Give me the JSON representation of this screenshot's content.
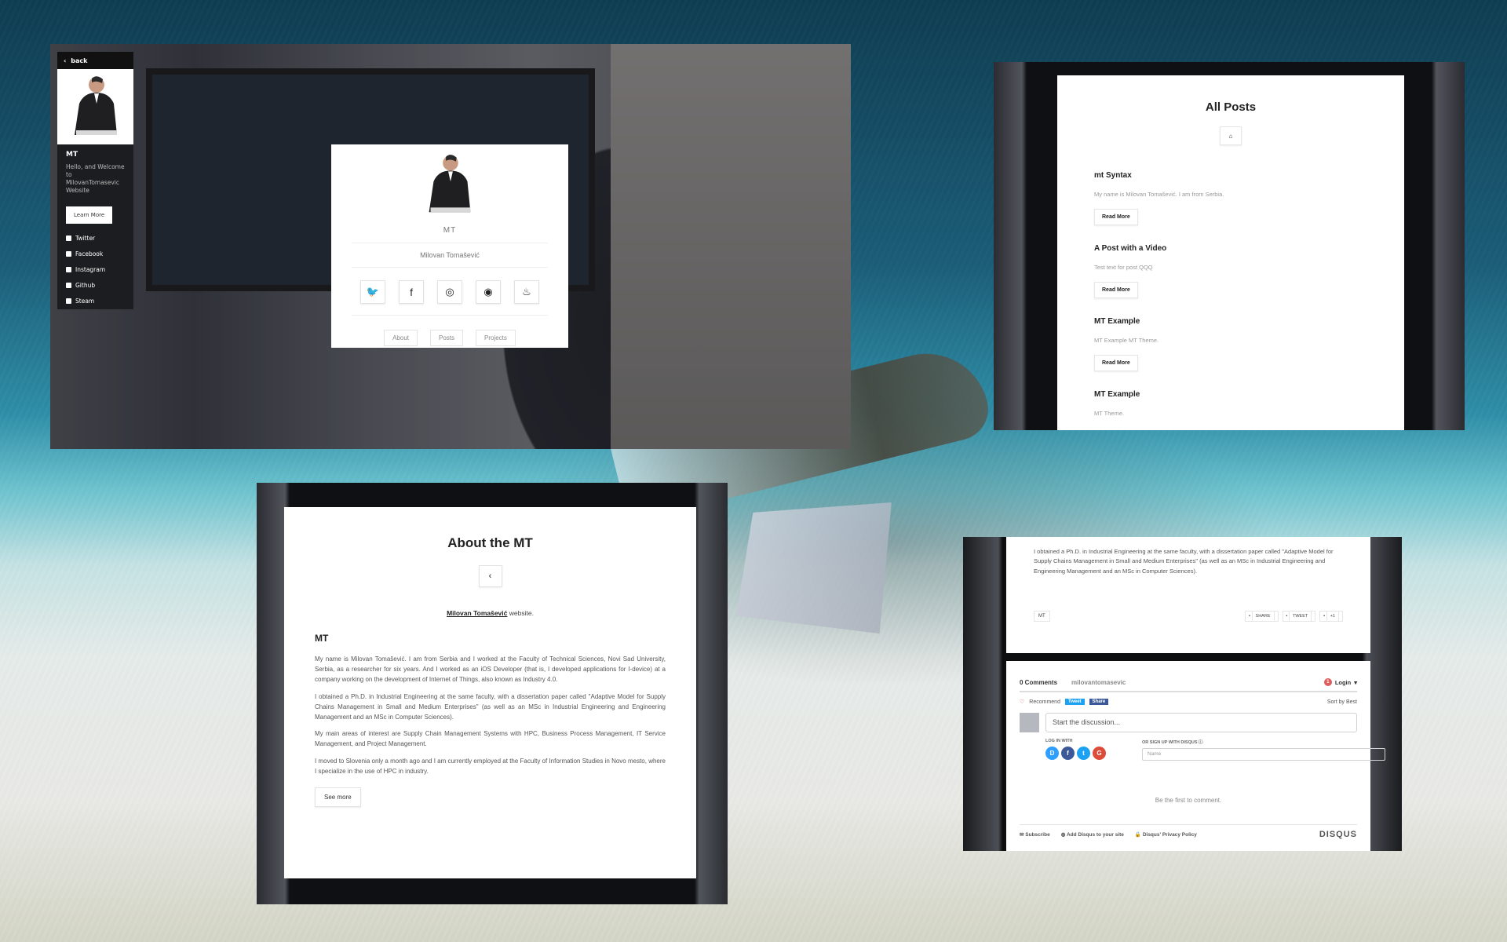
{
  "sidebar": {
    "back": "back",
    "name": "MT",
    "welcome": "Hello, and Welcome to MilovanTomasevic Website",
    "learn_more": "Learn More",
    "links": [
      {
        "label": "Twitter",
        "icon": "twitter-icon"
      },
      {
        "label": "Facebook",
        "icon": "facebook-icon"
      },
      {
        "label": "Instagram",
        "icon": "instagram-icon"
      },
      {
        "label": "Github",
        "icon": "github-icon"
      },
      {
        "label": "Steam",
        "icon": "steam-icon"
      }
    ]
  },
  "profile": {
    "title": "MT",
    "full_name": "Milovan Tomašević",
    "socials": [
      {
        "icon": "twitter-icon",
        "glyph": "🐦"
      },
      {
        "icon": "facebook-icon",
        "glyph": "f"
      },
      {
        "icon": "instagram-icon",
        "glyph": "◎"
      },
      {
        "icon": "github-icon",
        "glyph": "◉"
      },
      {
        "icon": "steam-icon",
        "glyph": "♨"
      }
    ],
    "nav": [
      "About",
      "Posts",
      "Projects"
    ]
  },
  "all_posts": {
    "title": "All Posts",
    "home_glyph": "⌂",
    "read_more": "Read More",
    "posts": [
      {
        "title": "mt Syntax",
        "excerpt": "My name is Milovan Tomašević. I am from Serbia."
      },
      {
        "title": "A Post with a Video",
        "excerpt": "Test text for post QQQ"
      },
      {
        "title": "MT Example",
        "excerpt": "MT Example MT Theme."
      },
      {
        "title": "MT Example",
        "excerpt": "MT Theme."
      }
    ]
  },
  "about": {
    "title": "About the MT",
    "back_glyph": "‹",
    "intro_name": "Milovan Tomašević",
    "intro_suffix": " website.",
    "heading": "MT",
    "paragraphs": [
      "My name is Milovan Tomašević. I am from Serbia and I worked at the Faculty of Technical Sciences, Novi Sad University, Serbia, as a researcher for six years. And I worked as an iOS Developer (that is, I developed applications for I-device) at a company working on the development of Internet of Things, also known as Industry 4.0.",
      "I obtained a Ph.D. in Industrial Engineering at the same faculty, with a dissertation paper called \"Adaptive Model for Supply Chains Management in Small and Medium Enterprises\" (as well as an MSc in Industrial Engineering and Engineering Management and an MSc in Computer Sciences).",
      "My main areas of interest are Supply Chain Management Systems with HPC, Business Process Management, IT Service Management, and Project Management.",
      "I moved to Slovenia only a month ago and I am currently employed at the Faculty of Information Studies in Novo mesto, where I specialize in the use of HPC in industry."
    ],
    "see_more": "See more"
  },
  "post_detail": {
    "paragraph": "I obtained a Ph.D. in Industrial Engineering at the same faculty, with a dissertation paper called \"Adaptive Model for Supply Chains Management in Small and Medium Enterprises\" (as well as an MSc in Industrial Engineering and Engineering Management and an MSc in Computer Sciences).",
    "tag": "MT",
    "share": "SHARE",
    "tweet": "TWEET",
    "plus": "+1"
  },
  "disqus": {
    "comments": "0 Comments",
    "site": "milovantomasevic",
    "login": "Login",
    "login_badge": "1",
    "recommend": "Recommend",
    "tweet": "Tweet",
    "share": "Share",
    "sort": "Sort by Best",
    "placeholder": "Start the discussion...",
    "log_in_with": "LOG IN WITH",
    "sign_up_with": "OR SIGN UP WITH DISQUS",
    "name_placeholder": "Name",
    "first": "Be the first to comment.",
    "subscribe": "Subscribe",
    "add_disqus": "Add Disqus to your site",
    "privacy": "Disqus' Privacy Policy",
    "brand": "DISQUS",
    "providers": [
      {
        "letter": "D",
        "color": "#2e9fff"
      },
      {
        "letter": "f",
        "color": "#3b5998"
      },
      {
        "letter": "t",
        "color": "#1da1f2"
      },
      {
        "letter": "G",
        "color": "#dd4b39"
      }
    ]
  }
}
